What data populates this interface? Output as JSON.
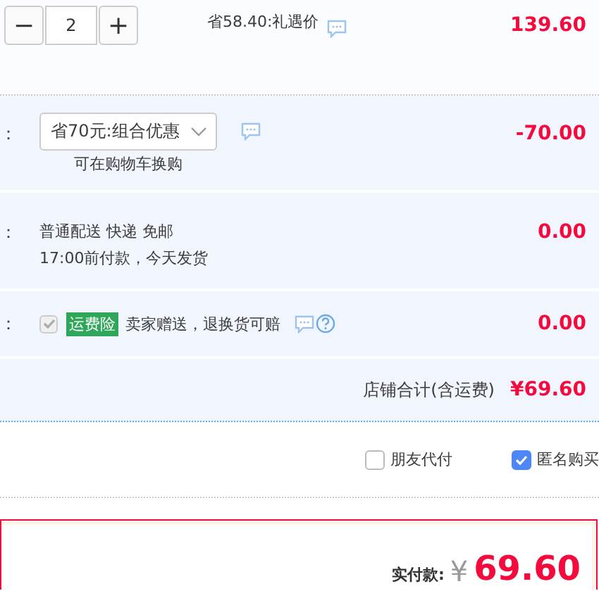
{
  "item": {
    "quantity": {
      "minus": "−",
      "value": "2",
      "plus": "+"
    },
    "discount_note": "省58.40:礼遇价",
    "price": "139.60"
  },
  "rows": [
    {
      "kind": "promo",
      "label": "：",
      "dropdown": "省70元:组合优惠",
      "note": "可在购物车换购",
      "amount": "-70.00"
    },
    {
      "kind": "shipping",
      "label": "：",
      "lines": [
        "普通配送 快递 免邮",
        "17:00前付款，今天发货"
      ],
      "amount": "0.00"
    },
    {
      "kind": "insurance",
      "label": "：",
      "checked": true,
      "disabled": true,
      "tag": "运费险",
      "text": "卖家赠送，退换货可赔",
      "amount": "0.00"
    }
  ],
  "shop_total": {
    "label": "店铺合计(含运费)",
    "amount": "¥69.60"
  },
  "options": [
    {
      "label": "朋友代付",
      "checked": false
    },
    {
      "label": "匿名购买",
      "checked": true
    }
  ],
  "payment": {
    "label": "实付款:",
    "currency": "¥",
    "amount": "69.60"
  }
}
